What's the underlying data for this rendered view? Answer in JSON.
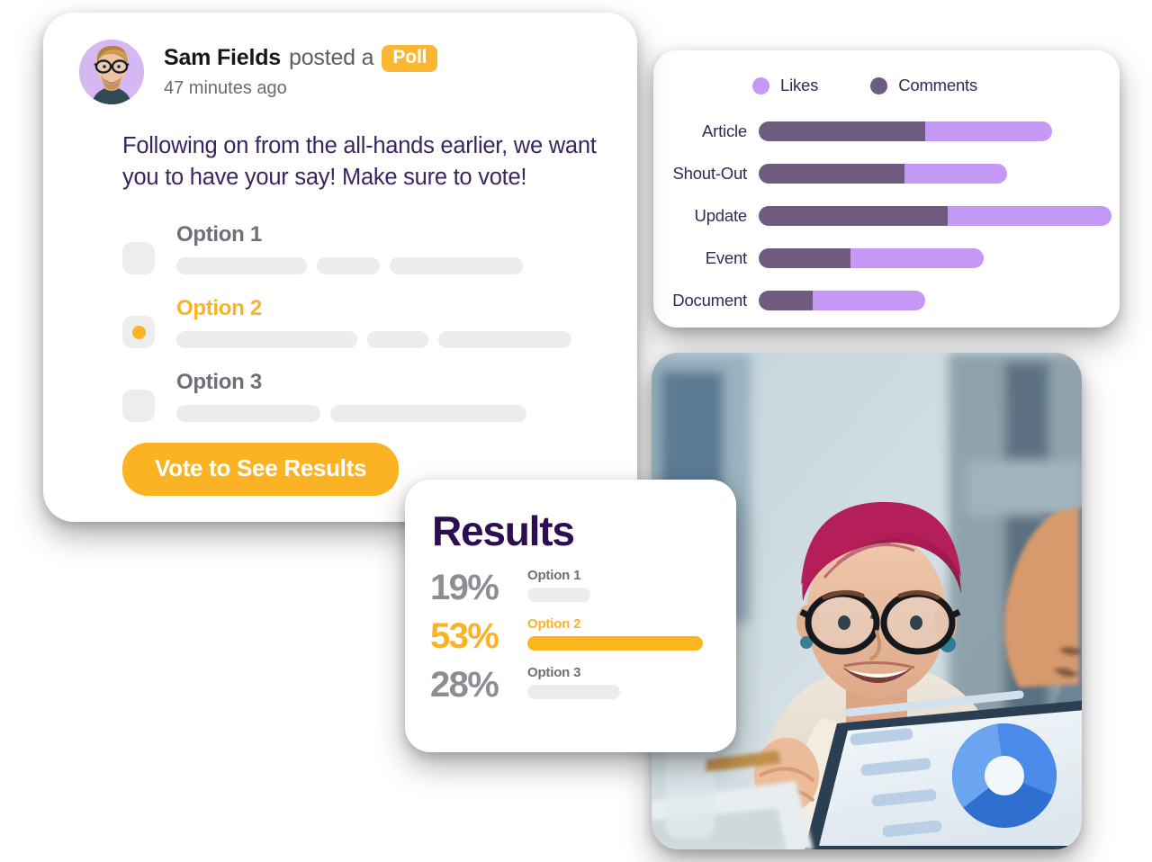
{
  "poll": {
    "author": "Sam Fields",
    "posted_text": "posted a",
    "badge": "Poll",
    "timestamp": "47 minutes ago",
    "body": "Following on from the all-hands earlier, we want you to have your say! Make sure to vote!",
    "vote_button": "Vote to See Results",
    "avatar_bg": "#d5b8f2",
    "accent": "#fbb324",
    "text_color": "#3a2560",
    "options": [
      {
        "label": "Option 1",
        "selected": false,
        "skeletons": [
          145,
          70,
          148
        ]
      },
      {
        "label": "Option 2",
        "selected": true,
        "skeletons": [
          201,
          68,
          148
        ]
      },
      {
        "label": "Option 3",
        "selected": false,
        "skeletons": [
          160,
          218
        ]
      }
    ]
  },
  "results": {
    "title": "Results",
    "title_color": "#2d0e52",
    "rows": [
      {
        "percent": "19%",
        "label": "Option 1",
        "value": 19,
        "selected": false
      },
      {
        "percent": "53%",
        "label": "Option 2",
        "value": 53,
        "selected": true
      },
      {
        "percent": "28%",
        "label": "Option 3",
        "value": 28,
        "selected": false
      }
    ]
  },
  "chart_data": {
    "type": "bar",
    "orientation": "horizontal",
    "stacked": true,
    "title": "",
    "xlabel": "",
    "ylabel": "",
    "grid": false,
    "legend_position": "top",
    "legend": [
      {
        "name": "Likes",
        "color": "#c598f5"
      },
      {
        "name": "Comments",
        "color": "#6e5b80"
      }
    ],
    "categories": [
      "Article",
      "Shout-Out",
      "Update",
      "Event",
      "Document"
    ],
    "series": [
      {
        "name": "Comments",
        "color": "#6e5b80",
        "values": [
          62,
          54,
          71,
          34,
          20
        ]
      },
      {
        "name": "Likes",
        "color": "#c598f5",
        "values": [
          47,
          38,
          61,
          50,
          42
        ]
      }
    ],
    "bar_pixel_widths": {
      "Article": {
        "comments": 185,
        "likes": 141
      },
      "Shout-Out": {
        "comments": 162,
        "likes": 114
      },
      "Update": {
        "comments": 210,
        "likes": 182
      },
      "Event": {
        "comments": 102,
        "likes": 148
      },
      "Document": {
        "comments": 60,
        "likes": 125
      }
    }
  },
  "photo": {
    "alt": "Smiling woman with pink hair and glasses at a desk with laptop",
    "laptop_chart": "donut-chart"
  }
}
